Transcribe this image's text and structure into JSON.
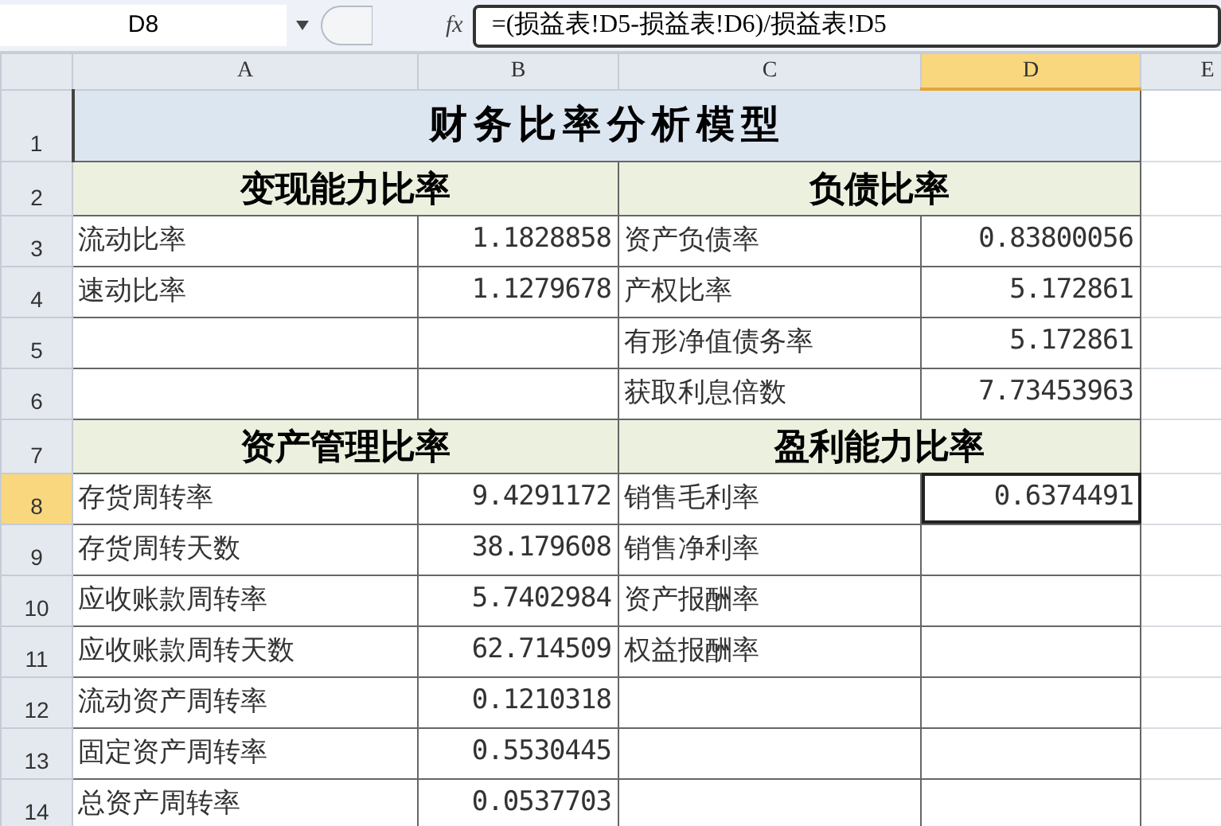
{
  "formula_bar": {
    "name_box": "D8",
    "function_label": "fx",
    "formula": "=(损益表!D5-损益表!D6)/损益表!D5"
  },
  "columns": [
    {
      "label": "A",
      "selected": false
    },
    {
      "label": "B",
      "selected": false
    },
    {
      "label": "C",
      "selected": false
    },
    {
      "label": "D",
      "selected": true
    },
    {
      "label": "E",
      "selected": false
    }
  ],
  "rows": [
    {
      "number": "1",
      "selected": false,
      "cells": [
        {
          "kind": "title",
          "text": "财务比率分析模型",
          "selected": false
        }
      ]
    },
    {
      "number": "2",
      "selected": false,
      "cells": [
        {
          "kind": "section",
          "text": "变现能力比率",
          "selected": false
        },
        {
          "kind": "section",
          "text": "负债比率",
          "selected": false
        }
      ]
    },
    {
      "number": "3",
      "selected": false,
      "cells": [
        {
          "kind": "label",
          "text": "流动比率",
          "selected": false
        },
        {
          "kind": "value",
          "text": "1.1828858",
          "selected": false
        },
        {
          "kind": "label",
          "text": "资产负债率",
          "selected": false
        },
        {
          "kind": "value",
          "text": "0.83800056",
          "selected": false
        }
      ]
    },
    {
      "number": "4",
      "selected": false,
      "cells": [
        {
          "kind": "label",
          "text": "速动比率",
          "selected": false
        },
        {
          "kind": "value",
          "text": "1.1279678",
          "selected": false
        },
        {
          "kind": "label",
          "text": "产权比率",
          "selected": false
        },
        {
          "kind": "value",
          "text": "5.172861",
          "selected": false
        }
      ]
    },
    {
      "number": "5",
      "selected": false,
      "cells": [
        {
          "kind": "empty",
          "selected": false
        },
        {
          "kind": "empty",
          "selected": false
        },
        {
          "kind": "label",
          "text": "有形净值债务率",
          "selected": false
        },
        {
          "kind": "value",
          "text": "5.172861",
          "selected": false
        }
      ]
    },
    {
      "number": "6",
      "selected": false,
      "cells": [
        {
          "kind": "empty",
          "selected": false
        },
        {
          "kind": "empty",
          "selected": false
        },
        {
          "kind": "label",
          "text": "获取利息倍数",
          "selected": false
        },
        {
          "kind": "value",
          "text": "7.73453963",
          "selected": false
        }
      ]
    },
    {
      "number": "7",
      "selected": false,
      "cells": [
        {
          "kind": "section",
          "text": "资产管理比率",
          "selected": false
        },
        {
          "kind": "section",
          "text": "盈利能力比率",
          "selected": false
        }
      ]
    },
    {
      "number": "8",
      "selected": true,
      "cells": [
        {
          "kind": "label",
          "text": "存货周转率",
          "selected": false
        },
        {
          "kind": "value",
          "text": "9.4291172",
          "selected": false
        },
        {
          "kind": "label",
          "text": "销售毛利率",
          "selected": false
        },
        {
          "kind": "value",
          "text": "0.6374491",
          "selected": true
        }
      ]
    },
    {
      "number": "9",
      "selected": false,
      "cells": [
        {
          "kind": "label",
          "text": "存货周转天数",
          "selected": false
        },
        {
          "kind": "value",
          "text": "38.179608",
          "selected": false
        },
        {
          "kind": "label",
          "text": "销售净利率",
          "selected": false
        },
        {
          "kind": "empty",
          "selected": false
        }
      ]
    },
    {
      "number": "10",
      "selected": false,
      "cells": [
        {
          "kind": "label",
          "text": "应收账款周转率",
          "selected": false
        },
        {
          "kind": "value",
          "text": "5.7402984",
          "selected": false
        },
        {
          "kind": "label",
          "text": "资产报酬率",
          "selected": false
        },
        {
          "kind": "empty",
          "selected": false
        }
      ]
    },
    {
      "number": "11",
      "selected": false,
      "cells": [
        {
          "kind": "label",
          "text": "应收账款周转天数",
          "selected": false
        },
        {
          "kind": "value",
          "text": "62.714509",
          "selected": false
        },
        {
          "kind": "label",
          "text": "权益报酬率",
          "selected": false
        },
        {
          "kind": "empty",
          "selected": false
        }
      ]
    },
    {
      "number": "12",
      "selected": false,
      "cells": [
        {
          "kind": "label",
          "text": "流动资产周转率",
          "selected": false
        },
        {
          "kind": "value",
          "text": "0.1210318",
          "selected": false
        },
        {
          "kind": "empty",
          "selected": false
        },
        {
          "kind": "empty",
          "selected": false
        }
      ]
    },
    {
      "number": "13",
      "selected": false,
      "cells": [
        {
          "kind": "label",
          "text": "固定资产周转率",
          "selected": false
        },
        {
          "kind": "value",
          "text": "0.5530445",
          "selected": false
        },
        {
          "kind": "empty",
          "selected": false
        },
        {
          "kind": "empty",
          "selected": false
        }
      ]
    },
    {
      "number": "14",
      "selected": false,
      "cells": [
        {
          "kind": "label",
          "text": "总资产周转率",
          "selected": false
        },
        {
          "kind": "value",
          "text": "0.0537703",
          "selected": false
        },
        {
          "kind": "empty",
          "selected": false
        },
        {
          "kind": "empty",
          "selected": false
        }
      ]
    }
  ]
}
